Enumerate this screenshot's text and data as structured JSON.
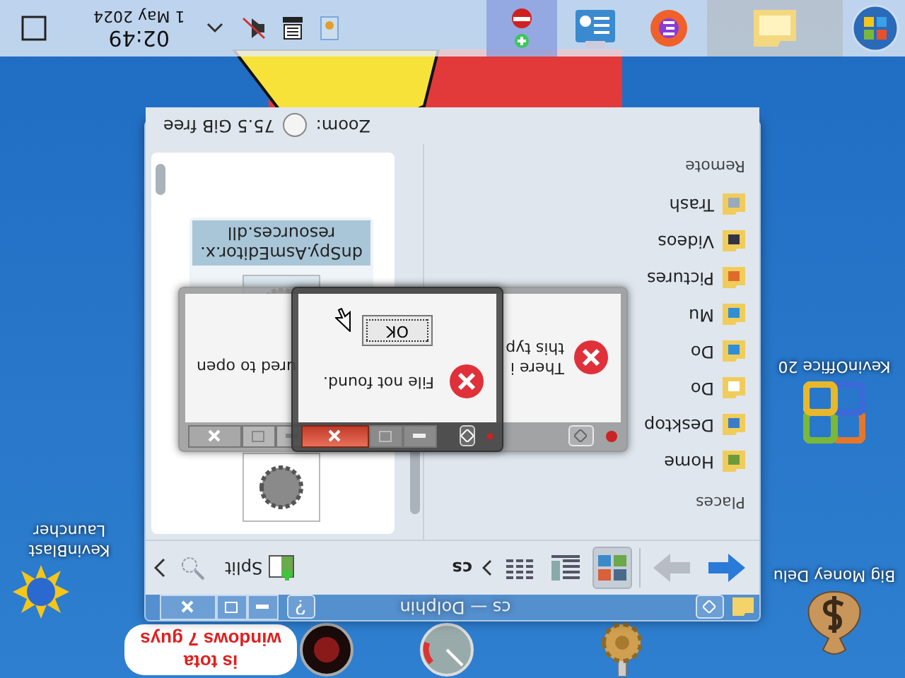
{
  "taskbar": {
    "apps": [
      {
        "kind": "files",
        "selected": true
      },
      {
        "kind": "browser",
        "selected": false
      },
      {
        "kind": "settings",
        "selected": false
      },
      {
        "kind": "installer",
        "selected": true
      }
    ],
    "tray": {
      "time": "02:49",
      "date": "1 May 2024",
      "muted": true
    }
  },
  "desktop": {
    "icons": [
      {
        "kind": "money",
        "label": "Big Money Delu"
      },
      {
        "kind": "office",
        "label": "KevinOffice 20"
      },
      {
        "kind": "launcher",
        "label": "KevinBlast Launcher"
      }
    ],
    "sticker": {
      "lines": [
        "is tota",
        "windows 7 guys"
      ]
    }
  },
  "dolphin": {
    "title": "cs — Dolphin",
    "toolbar": {
      "views": [
        {
          "kind": "icons",
          "selected": true
        },
        {
          "kind": "compact",
          "selected": false
        },
        {
          "kind": "details",
          "selected": false
        }
      ],
      "path": "cs",
      "split": "Split"
    },
    "places": {
      "heading": "Places",
      "items": [
        {
          "kind": "home",
          "label": "Home"
        },
        {
          "kind": "desktop",
          "label": "Desktop"
        },
        {
          "kind": "documents",
          "label": "Do"
        },
        {
          "kind": "downloads",
          "label": "Do"
        },
        {
          "kind": "music",
          "label": "Mu"
        },
        {
          "kind": "pictures",
          "label": "Pictures"
        },
        {
          "kind": "videos",
          "label": "Videos"
        },
        {
          "kind": "trash",
          "label": "Trash"
        }
      ],
      "remote": "Remote"
    },
    "files": [
      {
        "selected": false
      },
      {
        "selected": true,
        "label": [
          "dnSpy.AsmEditor.x.",
          "resources.dll"
        ]
      }
    ],
    "status": {
      "zoom": "Zoom:",
      "free": "75.5 GiB free"
    }
  },
  "dialog_back": {
    "active": false,
    "text_before": [
      "There i",
      "this typ"
    ],
    "text_after": "ured to open"
  },
  "dialog_front": {
    "active": true,
    "message": "File not found.",
    "button": "OK"
  }
}
